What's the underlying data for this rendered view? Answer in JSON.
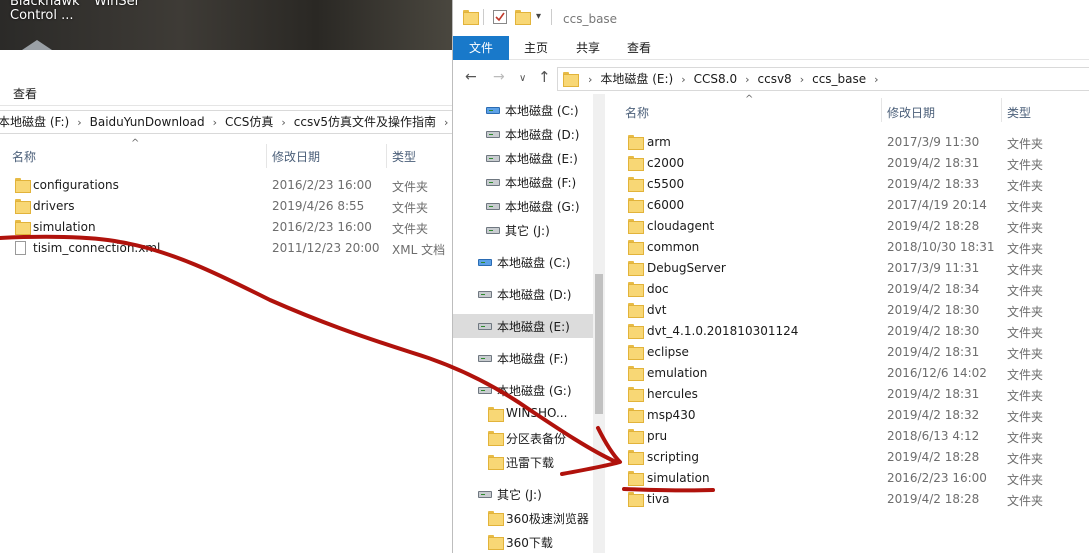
{
  "desktop": {
    "icon1_line1": "Blackhawk",
    "icon1_line2": "Control ...",
    "icon2_line1": "WinSer"
  },
  "left_window": {
    "ribbon_tab": "查看",
    "breadcrumbs": [
      "本地磁盘 (F:)",
      "BaiduYunDownload",
      "CCS仿真",
      "ccsv5仿真文件及操作指南"
    ],
    "columns": {
      "name": "名称",
      "date": "修改日期",
      "type": "类型"
    },
    "files": [
      {
        "name": "configurations",
        "date": "2016/2/23 16:00",
        "type": "文件夹",
        "icon": "folder-icon"
      },
      {
        "name": "drivers",
        "date": "2019/4/26 8:55",
        "type": "文件夹",
        "icon": "folder-icon"
      },
      {
        "name": "simulation",
        "date": "2016/2/23 16:00",
        "type": "文件夹",
        "icon": "folder-icon"
      },
      {
        "name": "tisim_connection.xml",
        "date": "2011/12/23 20:00",
        "type": "XML 文档",
        "icon": "xml-file-icon"
      }
    ]
  },
  "right_window": {
    "title": "ccs_base",
    "ribbon_tabs": [
      "文件",
      "主页",
      "共享",
      "查看"
    ],
    "breadcrumbs": [
      "本地磁盘 (E:)",
      "CCS8.0",
      "ccsv8",
      "ccs_base"
    ],
    "columns": {
      "name": "名称",
      "date": "修改日期",
      "type": "类型"
    },
    "nav_items": [
      {
        "label": "本地磁盘 (C:)",
        "icon": "drive-icon",
        "indent": 2,
        "sys": true
      },
      {
        "label": "本地磁盘 (D:)",
        "icon": "drive-icon",
        "indent": 2
      },
      {
        "label": "本地磁盘 (E:)",
        "icon": "drive-icon",
        "indent": 2
      },
      {
        "label": "本地磁盘 (F:)",
        "icon": "drive-icon",
        "indent": 2
      },
      {
        "label": "本地磁盘 (G:)",
        "icon": "drive-icon",
        "indent": 2
      },
      {
        "label": "其它 (J:)",
        "icon": "drive-icon",
        "indent": 2
      },
      {
        "label": "本地磁盘 (C:)",
        "icon": "drive-icon",
        "indent": 1,
        "sys": true
      },
      {
        "label": "本地磁盘 (D:)",
        "icon": "drive-icon",
        "indent": 1
      },
      {
        "label": "本地磁盘 (E:)",
        "icon": "drive-icon",
        "indent": 1,
        "selected": true
      },
      {
        "label": "本地磁盘 (F:)",
        "icon": "drive-icon",
        "indent": 1
      },
      {
        "label": "本地磁盘 (G:)",
        "icon": "drive-icon",
        "indent": 1
      },
      {
        "label": "WINSHO...",
        "icon": "folder-icon",
        "indent": 3
      },
      {
        "label": "分区表备份",
        "icon": "folder-icon",
        "indent": 3
      },
      {
        "label": "迅雷下载",
        "icon": "folder-icon",
        "indent": 3
      },
      {
        "label": "其它 (J:)",
        "icon": "drive-icon",
        "indent": 1
      },
      {
        "label": "360极速浏览器",
        "icon": "folder-icon",
        "indent": 3
      },
      {
        "label": "360下载",
        "icon": "folder-icon",
        "indent": 3
      }
    ],
    "files": [
      {
        "name": "arm",
        "date": "2017/3/9 11:30",
        "type": "文件夹"
      },
      {
        "name": "c2000",
        "date": "2019/4/2 18:31",
        "type": "文件夹"
      },
      {
        "name": "c5500",
        "date": "2019/4/2 18:33",
        "type": "文件夹"
      },
      {
        "name": "c6000",
        "date": "2017/4/19 20:14",
        "type": "文件夹"
      },
      {
        "name": "cloudagent",
        "date": "2019/4/2 18:28",
        "type": "文件夹"
      },
      {
        "name": "common",
        "date": "2018/10/30 18:31",
        "type": "文件夹"
      },
      {
        "name": "DebugServer",
        "date": "2017/3/9 11:31",
        "type": "文件夹"
      },
      {
        "name": "doc",
        "date": "2019/4/2 18:34",
        "type": "文件夹"
      },
      {
        "name": "dvt",
        "date": "2019/4/2 18:30",
        "type": "文件夹"
      },
      {
        "name": "dvt_4.1.0.201810301124",
        "date": "2019/4/2 18:30",
        "type": "文件夹"
      },
      {
        "name": "eclipse",
        "date": "2019/4/2 18:31",
        "type": "文件夹"
      },
      {
        "name": "emulation",
        "date": "2016/12/6 14:02",
        "type": "文件夹"
      },
      {
        "name": "hercules",
        "date": "2019/4/2 18:31",
        "type": "文件夹"
      },
      {
        "name": "msp430",
        "date": "2019/4/2 18:32",
        "type": "文件夹"
      },
      {
        "name": "pru",
        "date": "2018/6/13 4:12",
        "type": "文件夹"
      },
      {
        "name": "scripting",
        "date": "2019/4/2 18:28",
        "type": "文件夹"
      },
      {
        "name": "simulation",
        "date": "2016/2/23 16:00",
        "type": "文件夹"
      },
      {
        "name": "tiva",
        "date": "2019/4/2 18:28",
        "type": "文件夹"
      }
    ]
  },
  "colors": {
    "accent": "#1979ca",
    "folder": "#f8d775",
    "annotation": "#b0120c"
  }
}
